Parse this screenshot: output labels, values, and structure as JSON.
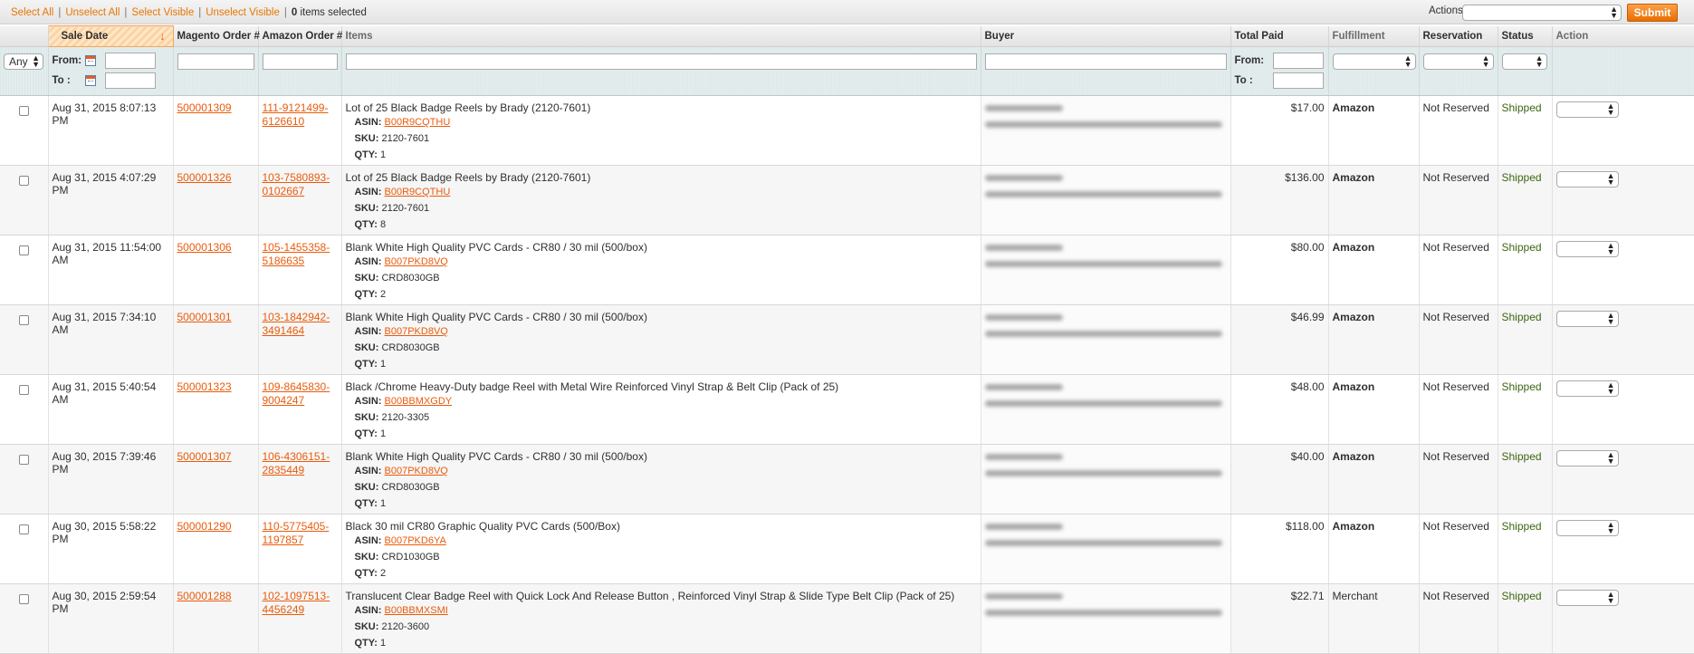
{
  "massaction": {
    "select_all": "Select All",
    "unselect_all": "Unselect All",
    "select_visible": "Select Visible",
    "unselect_visible": "Unselect Visible",
    "sep": "|",
    "selected_count": "0",
    "selected_suffix": "items selected",
    "actions_label": "Actions",
    "actions_value": "",
    "submit_label": "Submit"
  },
  "columns": {
    "sale_date": "Sale Date",
    "magento_order": "Magento Order #",
    "amazon_order": "Amazon Order #",
    "items": "Items",
    "buyer": "Buyer",
    "total_paid": "Total Paid",
    "fulfillment": "Fulfillment",
    "reservation": "Reservation",
    "status": "Status",
    "action": "Action",
    "sort_arrow": "↓"
  },
  "filters": {
    "any_value": "Any",
    "from_label": "From:",
    "to_label": "To :",
    "total_from_label": "From:",
    "total_to_label": "To :"
  },
  "item_meta_labels": {
    "asin": "ASIN:",
    "sku": "SKU:",
    "qty": "QTY:"
  },
  "rows": [
    {
      "date": "Aug 31, 2015 8:07:13 PM",
      "magento": "500001309",
      "amazon_a": "111-9121499-",
      "amazon_b": "6126610",
      "item": "Lot of 25 Black Badge Reels by Brady (2120-7601)",
      "asin": "B00R9CQTHU",
      "sku": "2120-7601",
      "qty": "1",
      "total": "$17.00",
      "fulfillment": "Amazon",
      "reservation": "Not Reserved",
      "status": "Shipped"
    },
    {
      "date": "Aug 31, 2015 4:07:29 PM",
      "magento": "500001326",
      "amazon_a": "103-7580893-",
      "amazon_b": "0102667",
      "item": "Lot of 25 Black Badge Reels by Brady (2120-7601)",
      "asin": "B00R9CQTHU",
      "sku": "2120-7601",
      "qty": "8",
      "total": "$136.00",
      "fulfillment": "Amazon",
      "reservation": "Not Reserved",
      "status": "Shipped"
    },
    {
      "date": "Aug 31, 2015 11:54:00 AM",
      "magento": "500001306",
      "amazon_a": "105-1455358-",
      "amazon_b": "5186635",
      "item": "Blank White High Quality PVC Cards - CR80 / 30 mil (500/box)",
      "asin": "B007PKD8VQ",
      "sku": "CRD8030GB",
      "qty": "2",
      "total": "$80.00",
      "fulfillment": "Amazon",
      "reservation": "Not Reserved",
      "status": "Shipped"
    },
    {
      "date": "Aug 31, 2015 7:34:10 AM",
      "magento": "500001301",
      "amazon_a": "103-1842942-",
      "amazon_b": "3491464",
      "item": "Blank White High Quality PVC Cards - CR80 / 30 mil (500/box)",
      "asin": "B007PKD8VQ",
      "sku": "CRD8030GB",
      "qty": "1",
      "total": "$46.99",
      "fulfillment": "Amazon",
      "reservation": "Not Reserved",
      "status": "Shipped"
    },
    {
      "date": "Aug 31, 2015 5:40:54 AM",
      "magento": "500001323",
      "amazon_a": "109-8645830-",
      "amazon_b": "9004247",
      "item": "Black /Chrome Heavy-Duty badge Reel with Metal Wire Reinforced Vinyl Strap & Belt Clip (Pack of 25)",
      "asin": "B00BBMXGDY",
      "sku": "2120-3305",
      "qty": "1",
      "total": "$48.00",
      "fulfillment": "Amazon",
      "reservation": "Not Reserved",
      "status": "Shipped"
    },
    {
      "date": "Aug 30, 2015 7:39:46 PM",
      "magento": "500001307",
      "amazon_a": "106-4306151-",
      "amazon_b": "2835449",
      "item": "Blank White High Quality PVC Cards - CR80 / 30 mil (500/box)",
      "asin": "B007PKD8VQ",
      "sku": "CRD8030GB",
      "qty": "1",
      "total": "$40.00",
      "fulfillment": "Amazon",
      "reservation": "Not Reserved",
      "status": "Shipped"
    },
    {
      "date": "Aug 30, 2015 5:58:22 PM",
      "magento": "500001290",
      "amazon_a": "110-5775405-",
      "amazon_b": "1197857",
      "item": "Black 30 mil CR80 Graphic Quality PVC Cards (500/Box)",
      "asin": "B007PKD6YA",
      "sku": "CRD1030GB",
      "qty": "2",
      "total": "$118.00",
      "fulfillment": "Amazon",
      "reservation": "Not Reserved",
      "status": "Shipped"
    },
    {
      "date": "Aug 30, 2015 2:59:54 PM",
      "magento": "500001288",
      "amazon_a": "102-1097513-",
      "amazon_b": "4456249",
      "item": "Translucent Clear Badge Reel with Quick Lock And Release Button , Reinforced Vinyl Strap & Slide Type Belt Clip (Pack of 25)",
      "asin": "B00BBMXSMI",
      "sku": "2120-3600",
      "qty": "1",
      "total": "$22.71",
      "fulfillment": "Merchant",
      "reservation": "Not Reserved",
      "status": "Shipped"
    }
  ],
  "colors": {
    "link": "#ea5b0c",
    "massaction_link": "#ea7601",
    "shipped": "#3d6611",
    "submit": "#ee7a10"
  }
}
